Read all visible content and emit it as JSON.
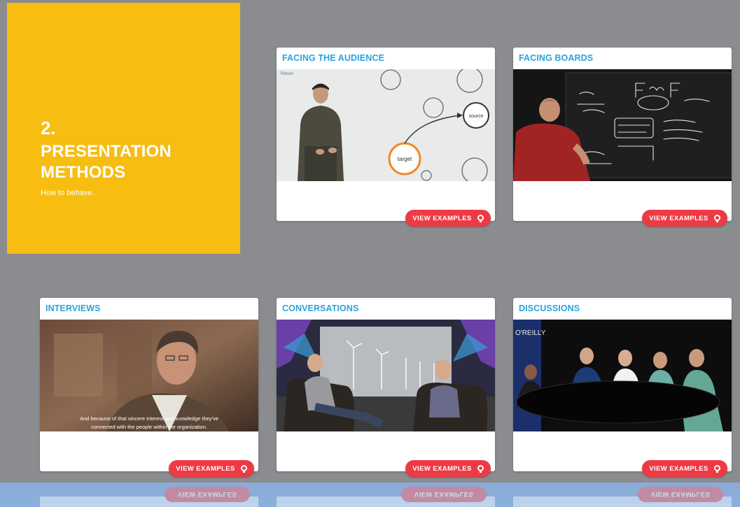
{
  "hero": {
    "number": "2.",
    "title_line1": "PRESENTATION",
    "title_line2": "METHODS",
    "subtitle": "How to behave."
  },
  "cards": [
    {
      "title": "FACING THE AUDIENCE",
      "button": "VIEW EXAMPLES",
      "thumb_text_1": "target",
      "thumb_text_2": "source",
      "thumb_corner": "Return"
    },
    {
      "title": "FACING BOARDS",
      "button": "VIEW EXAMPLES"
    },
    {
      "title": "INTERVIEWS",
      "button": "VIEW EXAMPLES",
      "caption_1": "And because of that sincere interest and knowledge they've",
      "caption_2": "connected with the people within the organization."
    },
    {
      "title": "CONVERSATIONS",
      "button": "VIEW EXAMPLES"
    },
    {
      "title": "DISCUSSIONS",
      "button": "VIEW EXAMPLES",
      "logo": "O'REILLY"
    }
  ],
  "reflection_button": "VIEW EXAMPLES",
  "colors": {
    "accent_yellow": "#f7bd11",
    "title_blue": "#2aa3dc",
    "button_red": "#ed3a45"
  }
}
